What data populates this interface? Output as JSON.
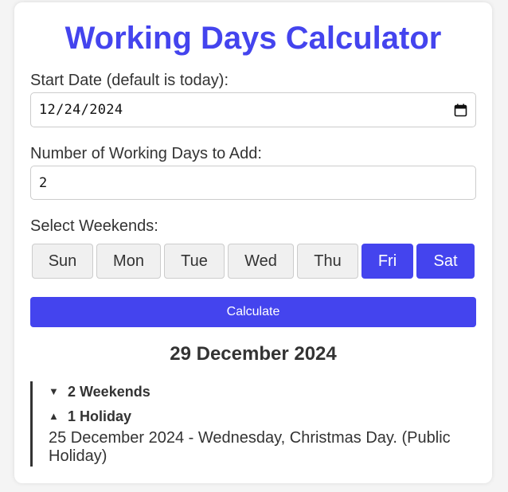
{
  "title": "Working Days Calculator",
  "start_date": {
    "label": "Start Date (default is today):",
    "value": "12/24/2024"
  },
  "days_to_add": {
    "label": "Number of Working Days to Add:",
    "value": "2"
  },
  "weekends": {
    "label": "Select Weekends:",
    "days": [
      {
        "label": "Sun",
        "selected": false
      },
      {
        "label": "Mon",
        "selected": false
      },
      {
        "label": "Tue",
        "selected": false
      },
      {
        "label": "Wed",
        "selected": false
      },
      {
        "label": "Thu",
        "selected": false
      },
      {
        "label": "Fri",
        "selected": true
      },
      {
        "label": "Sat",
        "selected": true
      }
    ]
  },
  "calculate_label": "Calculate",
  "result": {
    "date": "29 December 2024",
    "weekends_summary": "2 Weekends",
    "weekends_arrow": "▼",
    "holiday_summary": "1 Holiday",
    "holiday_arrow": "▲",
    "holiday_detail": "25 December 2024 - Wednesday, Christmas Day. (Public Holiday)"
  },
  "colors": {
    "accent": "#4444ee",
    "text": "#333333",
    "background": "#f4f4f4"
  }
}
